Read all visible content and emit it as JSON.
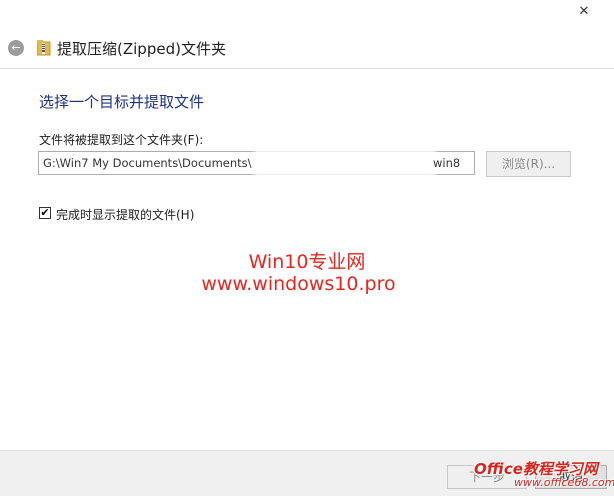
{
  "window": {
    "close_glyph": "✕"
  },
  "header": {
    "back_glyph": "←",
    "title": "提取压缩(Zipped)文件夹"
  },
  "main": {
    "instruction": "选择一个目标并提取文件",
    "dest_label": "文件将被提取到这个文件夹(F):",
    "path_prefix": "G:\\Win7 My Documents\\Documents\\",
    "path_suffix": "win8",
    "browse_label": "浏览(R)...",
    "checkbox": {
      "checked": true,
      "mark": "✔",
      "label": "完成时显示提取的文件(H)"
    }
  },
  "watermark": {
    "line1": "Win10专业网",
    "line2": "www.windows10.pro"
  },
  "footer": {
    "next_label": "下一步",
    "cancel_label": "取消"
  },
  "site_logo": {
    "text": "Office教程学习网",
    "url": "www.office68.com"
  },
  "colors": {
    "instruction": "#1e3287",
    "watermark": "#e8251f"
  },
  "icons": {
    "back": "back-arrow-icon",
    "folder": "zip-folder-icon",
    "close": "close-icon"
  }
}
